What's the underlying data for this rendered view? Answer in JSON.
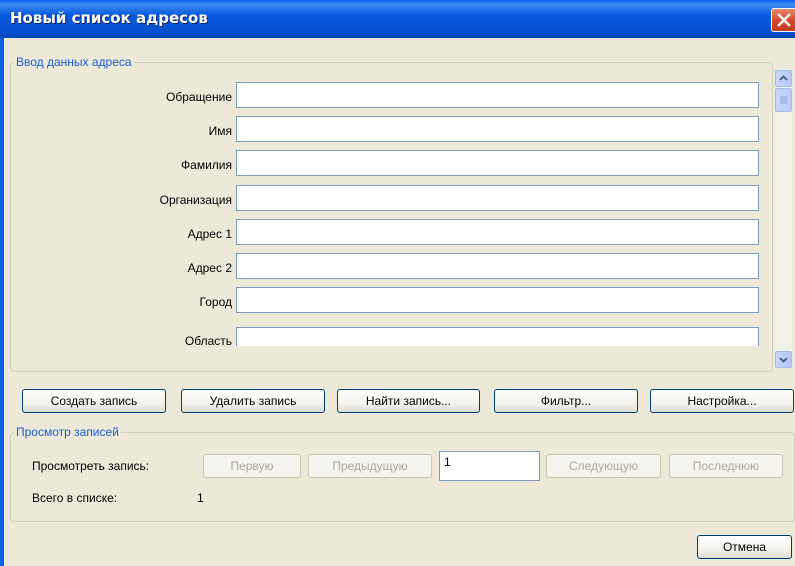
{
  "window": {
    "title": "Новый список адресов"
  },
  "entry_group": {
    "legend": "Ввод данных адреса",
    "fields": [
      {
        "label": "Обращение",
        "value": ""
      },
      {
        "label": "Имя",
        "value": ""
      },
      {
        "label": "Фамилия",
        "value": ""
      },
      {
        "label": "Организация",
        "value": ""
      },
      {
        "label": "Адрес 1",
        "value": ""
      },
      {
        "label": "Адрес 2",
        "value": ""
      },
      {
        "label": "Город",
        "value": ""
      },
      {
        "label": "Область",
        "value": ""
      }
    ]
  },
  "actions": {
    "create": "Создать запись",
    "delete": "Удалить запись",
    "find": "Найти запись...",
    "filter": "Фильтр...",
    "customize": "Настройка..."
  },
  "view_group": {
    "legend": "Просмотр записей",
    "view_label": "Просмотреть запись:",
    "first": "Первую",
    "previous": "Предыдущую",
    "record_number": "1",
    "next": "Следующую",
    "last": "Последнюю",
    "total_label": "Всего в списке:",
    "total_value": "1"
  },
  "footer": {
    "cancel": "Отмена"
  },
  "colors": {
    "title_bar": "#0a5fe6",
    "legend_text": "#1c5cd6",
    "dialog_bg": "#ece9d8"
  }
}
